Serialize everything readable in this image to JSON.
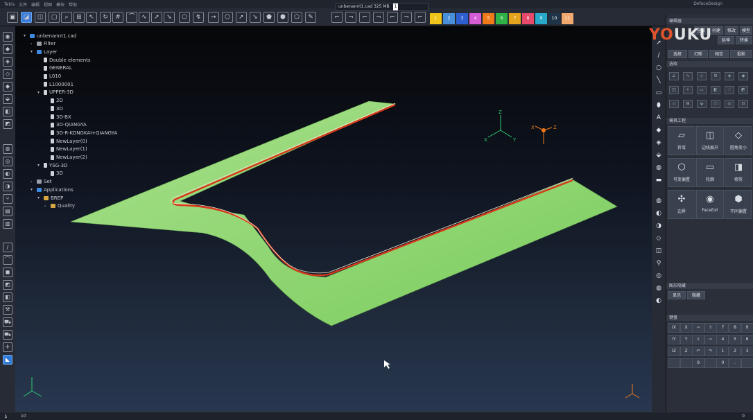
{
  "titlebar": {
    "menus": [
      "Tebis",
      "文件",
      "编辑",
      "视图",
      "模块",
      "帮助"
    ],
    "app_title": "DefaceDesign"
  },
  "file_tab": {
    "name": "unbenannt1.cad",
    "size": "325 MB",
    "num": "1"
  },
  "toolbar": {
    "icons": [
      "frame-icon",
      "view-iso-icon",
      "cube-icon",
      "window-icon",
      "zoom-icon",
      "grid-icon",
      "cursor-icon",
      "rotate-icon",
      "rotate-x-icon",
      "mesh-icon",
      "curve-icon",
      "curve-2-icon",
      "pointer-icon",
      "pointer-2-icon",
      "surface-icon",
      "loop-icon"
    ]
  },
  "color_swatches": [
    {
      "n": "1",
      "c": "#f0c419"
    },
    {
      "n": "2",
      "c": "#4a90d9"
    },
    {
      "n": "3",
      "c": "#2d5fd0"
    },
    {
      "n": "4",
      "c": "#d65cd6"
    },
    {
      "n": "5",
      "c": "#f07a1a"
    },
    {
      "n": "6",
      "c": "#2fb347"
    },
    {
      "n": "7",
      "c": "#e3a31c"
    },
    {
      "n": "8",
      "c": "#e84a6c"
    },
    {
      "n": "9",
      "c": "#28a9c9"
    },
    {
      "n": "10",
      "c": "#1f3448"
    },
    {
      "n": "11",
      "c": "#f2a96f"
    }
  ],
  "tree": [
    {
      "label": "unbenannt1.cad",
      "indent": 0,
      "arrow": "▾",
      "icon": "blue"
    },
    {
      "label": "Filter",
      "indent": 1,
      "arrow": "›",
      "icon": "gray"
    },
    {
      "label": "Layer",
      "indent": 1,
      "arrow": "▾",
      "icon": "blue"
    },
    {
      "label": "Double elements",
      "indent": 2,
      "arrow": "",
      "icon": "page"
    },
    {
      "label": "GENERAL",
      "indent": 2,
      "arrow": "",
      "icon": "page"
    },
    {
      "label": "L010",
      "indent": 2,
      "arrow": "",
      "icon": "page"
    },
    {
      "label": "L1000001",
      "indent": 2,
      "arrow": "",
      "icon": "page"
    },
    {
      "label": "UPPER-3D",
      "indent": 2,
      "arrow": "▾",
      "icon": "page"
    },
    {
      "label": "2D",
      "indent": 3,
      "arrow": "",
      "icon": "page"
    },
    {
      "label": "3D",
      "indent": 3,
      "arrow": "",
      "icon": "page"
    },
    {
      "label": "3D-BX",
      "indent": 3,
      "arrow": "",
      "icon": "page"
    },
    {
      "label": "3D-QIANGYA",
      "indent": 3,
      "arrow": "",
      "icon": "page"
    },
    {
      "label": "3D-R-KONGKAI+QIANGYA",
      "indent": 3,
      "arrow": "",
      "icon": "page"
    },
    {
      "label": "NewLayer(0)",
      "indent": 3,
      "arrow": "",
      "icon": "page"
    },
    {
      "label": "NewLayer(1)",
      "indent": 3,
      "arrow": "",
      "icon": "page"
    },
    {
      "label": "NewLayer(2)",
      "indent": 3,
      "arrow": "",
      "icon": "page"
    },
    {
      "label": "YSG-3D",
      "indent": 2,
      "arrow": "▾",
      "icon": "page"
    },
    {
      "label": "3D",
      "indent": 3,
      "arrow": "",
      "icon": "page"
    },
    {
      "label": "Set",
      "indent": 1,
      "arrow": "›",
      "icon": "gray"
    },
    {
      "label": "Applications",
      "indent": 1,
      "arrow": "▾",
      "icon": "blue"
    },
    {
      "label": "BREP",
      "indent": 2,
      "arrow": "▾",
      "icon": "yel"
    },
    {
      "label": "Quality",
      "indent": 3,
      "arrow": "›",
      "icon": "yel"
    }
  ],
  "panel": {
    "edit_header": "编辑器",
    "edit_tabs": [
      "全部",
      "创建",
      "修改",
      "模型"
    ],
    "edit_buttons": [
      "选择",
      "打断",
      "相交",
      "投影",
      "延伸",
      "转换"
    ],
    "select_header": "选取",
    "surface_header": "模具工程",
    "big_buttons": [
      {
        "icon": "▱",
        "label": "折弯"
      },
      {
        "icon": "◫",
        "label": "边线展开"
      },
      {
        "icon": "◇",
        "label": "圆角变小"
      },
      {
        "icon": "⬡",
        "label": "可变偏置"
      },
      {
        "icon": "▭",
        "label": "轮廓"
      },
      {
        "icon": "◨",
        "label": "修剪"
      },
      {
        "icon": "✣",
        "label": "边界"
      },
      {
        "icon": "◉",
        "label": "FaceExt"
      },
      {
        "icon": "⬢",
        "label": "不同偏置"
      }
    ],
    "display_header": "图形隐藏",
    "display_buttons": [
      "显示",
      "隐藏"
    ],
    "keypad_header": "键盘",
    "keypad": [
      "IX",
      "X",
      "⇦",
      "⇧",
      "7",
      "8",
      "9",
      "IY",
      "Y",
      "⇩",
      "⇨",
      "4",
      "5",
      "6",
      "IZ",
      "Z",
      "↶",
      "↷",
      "1",
      "2",
      "3",
      "",
      "",
      "9",
      "",
      "0",
      ".",
      ""
    ]
  },
  "status": {
    "left_num": "10",
    "right_num": "0"
  }
}
